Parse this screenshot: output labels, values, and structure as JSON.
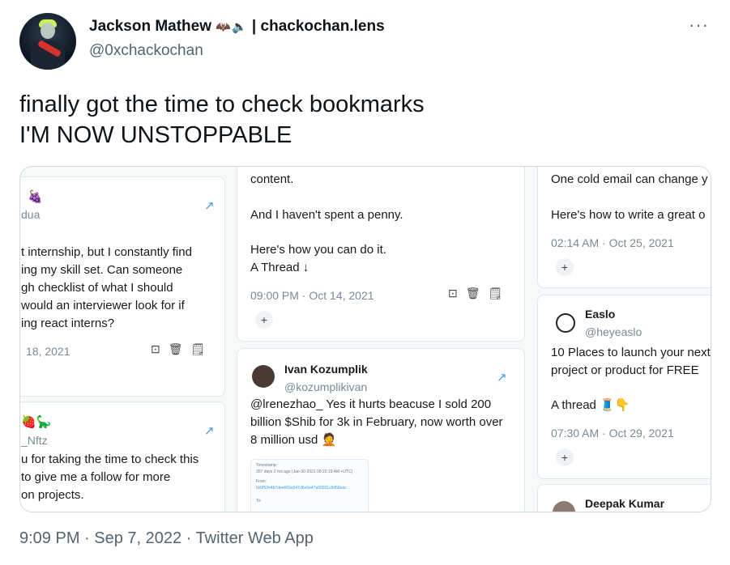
{
  "author": {
    "name": "Jackson Mathew",
    "name_emoji": "🦇🔈",
    "name_suffix": "| chackochan.lens",
    "handle": "@0xchackochan"
  },
  "more_icon": "···",
  "tweet": {
    "line1": "finally got the time to check bookmarks",
    "line2": "I'M NOW UNSTOPPABLE"
  },
  "media": {
    "col1": {
      "card1": {
        "emoji": "🍇",
        "handle_fragment": "dua",
        "lines": [
          "t internship, but I constantly find",
          "ing my skill set. Can someone",
          "gh checklist of what I should",
          "would an interviewer look for if",
          "ing react interns?"
        ],
        "date": "18, 2021"
      },
      "card2": {
        "emoji": "🍓🦕",
        "handle_fragment": "_Nftz",
        "lines": [
          "u for taking the time to check this",
          " to give me a follow for more",
          "on projects."
        ]
      }
    },
    "col2": {
      "card1": {
        "lines": [
          "content.",
          "",
          "And I haven't spent a penny.",
          "",
          "Here's how you can do it.",
          "A Thread ↓"
        ],
        "date": "09:00 PM · Oct 14, 2021"
      },
      "card2": {
        "name": "Ivan Kozumplik",
        "handle": "@kozumplikivan",
        "lines": [
          "@lrenezhao_ Yes it hurts beacuse I sold 200",
          "billion $Shib for 3k in February, now worth over",
          "8 million usd 🤦"
        ],
        "mini": {
          "l1": "Timestamp:",
          "l2": "357 days 2 hrs ago (Jan-30-2021 08:22:19 AM +UTC)",
          "l3": "From:",
          "l4": "0x0f52e4b7dee669a547d6e0e47a60031c0d58eac",
          "l5": "To:"
        }
      }
    },
    "col3": {
      "card1": {
        "lines": [
          "One cold email can change y",
          "",
          "Here's how to write a great o"
        ],
        "date": "02:14 AM · Oct 25, 2021"
      },
      "card2": {
        "name": "Easlo",
        "handle": "@heyeaslo",
        "lines": [
          "10 Places to launch your next",
          "project or product for FREE",
          "",
          "A thread 🧵👇"
        ],
        "date": "07:30 AM · Oct 29, 2021"
      },
      "card3": {
        "name": "Deepak Kumar"
      }
    },
    "plus_label": "+",
    "action_icons": "⊡🗑🗒",
    "ext_icon": "↗"
  },
  "footer": {
    "time": "9:09 PM",
    "sep1": " · ",
    "date": "Sep 7, 2022",
    "sep2": " · ",
    "source": "Twitter Web App"
  }
}
